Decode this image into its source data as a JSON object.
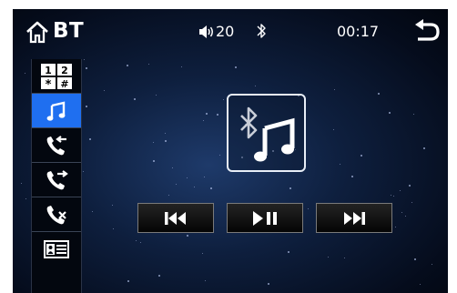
{
  "header": {
    "title": "BT",
    "volume": "20",
    "clock": "00:17"
  },
  "icons": {
    "home": "home-icon",
    "volume": "speaker-icon",
    "bluetooth": "bluetooth-icon",
    "back": "back-arrow-icon"
  },
  "sidebar": {
    "keypad_keys": [
      "1",
      "2",
      "*",
      "#"
    ],
    "items": [
      {
        "name": "dial-keypad",
        "icon": "keypad-icon"
      },
      {
        "name": "bt-music",
        "icon": "music-note-icon",
        "active": true
      },
      {
        "name": "received-calls",
        "icon": "incoming-call-icon"
      },
      {
        "name": "dialed-calls",
        "icon": "outgoing-call-icon"
      },
      {
        "name": "missed-calls",
        "icon": "missed-call-icon"
      },
      {
        "name": "phonebook",
        "icon": "contact-card-icon"
      }
    ]
  },
  "player": {
    "album_icon": "bluetooth-music-icon",
    "controls": [
      {
        "name": "previous",
        "icon": "skip-previous-icon"
      },
      {
        "name": "play-pause",
        "icon": "play-pause-icon"
      },
      {
        "name": "next",
        "icon": "skip-next-icon"
      }
    ]
  },
  "colors": {
    "active_item": "#1f6ff0",
    "background": "#0b1a36",
    "text": "#ffffff"
  }
}
